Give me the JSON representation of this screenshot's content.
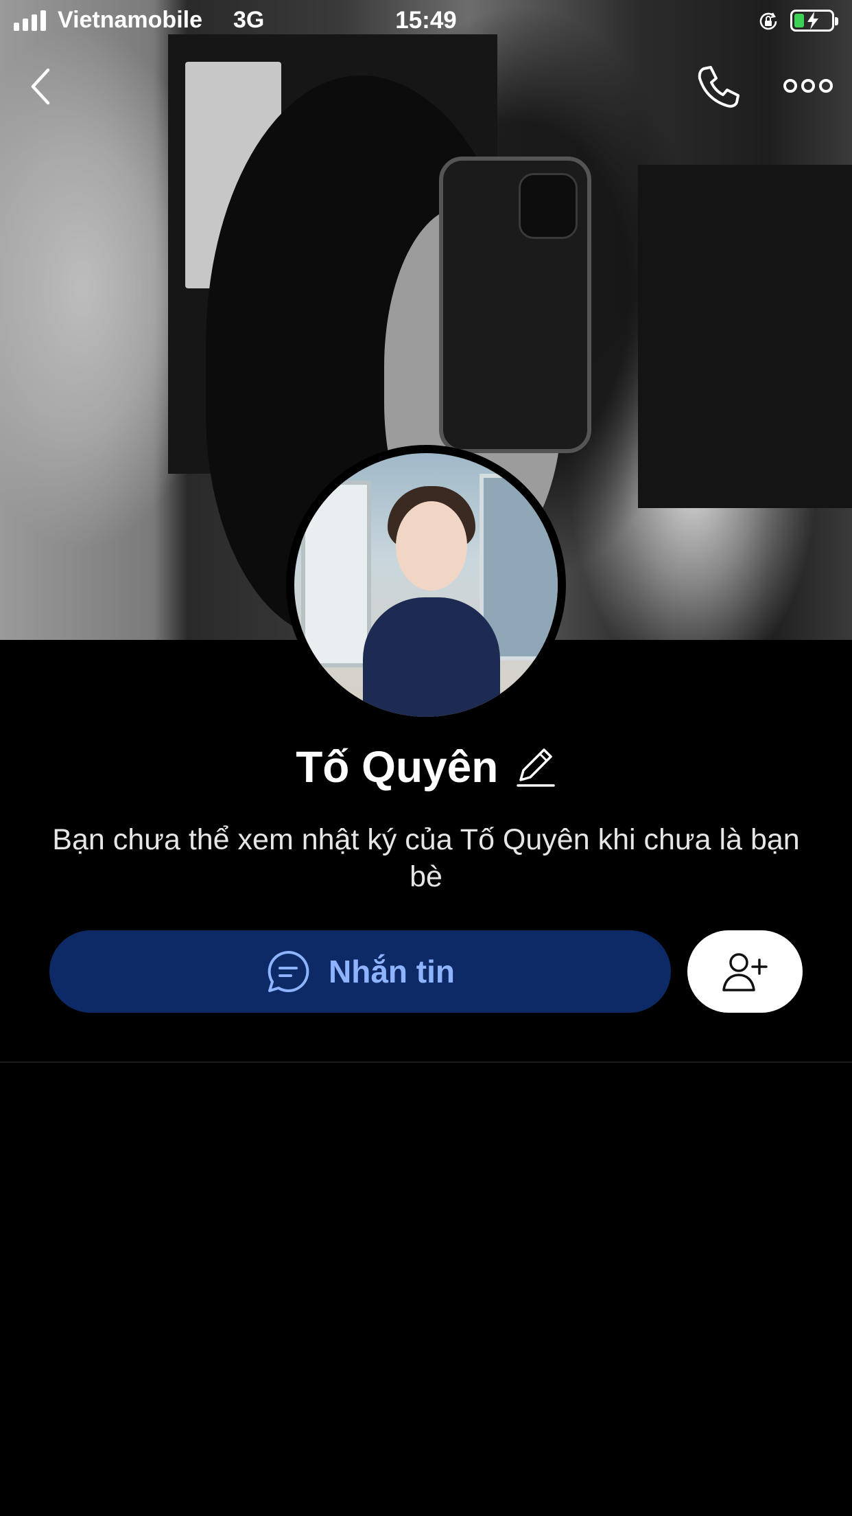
{
  "status_bar": {
    "carrier": "Vietnamobile",
    "network": "3G",
    "time": "15:49",
    "signal_bars": 4,
    "battery_color": "#3cd255"
  },
  "nav": {
    "back_icon": "chevron-left-icon",
    "call_icon": "phone-icon",
    "more_icon": "more-icon"
  },
  "profile": {
    "name": "Tố Quyên",
    "edit_icon": "pencil-icon",
    "notice": "Bạn chưa thể xem nhật ký của Tố Quyên khi chưa là bạn bè"
  },
  "actions": {
    "message_label": "Nhắn tin",
    "message_icon": "chat-bubble-icon",
    "add_friend_icon": "add-friend-icon",
    "message_button_color": "#0e2a66",
    "message_text_color": "#8fb4ff"
  }
}
